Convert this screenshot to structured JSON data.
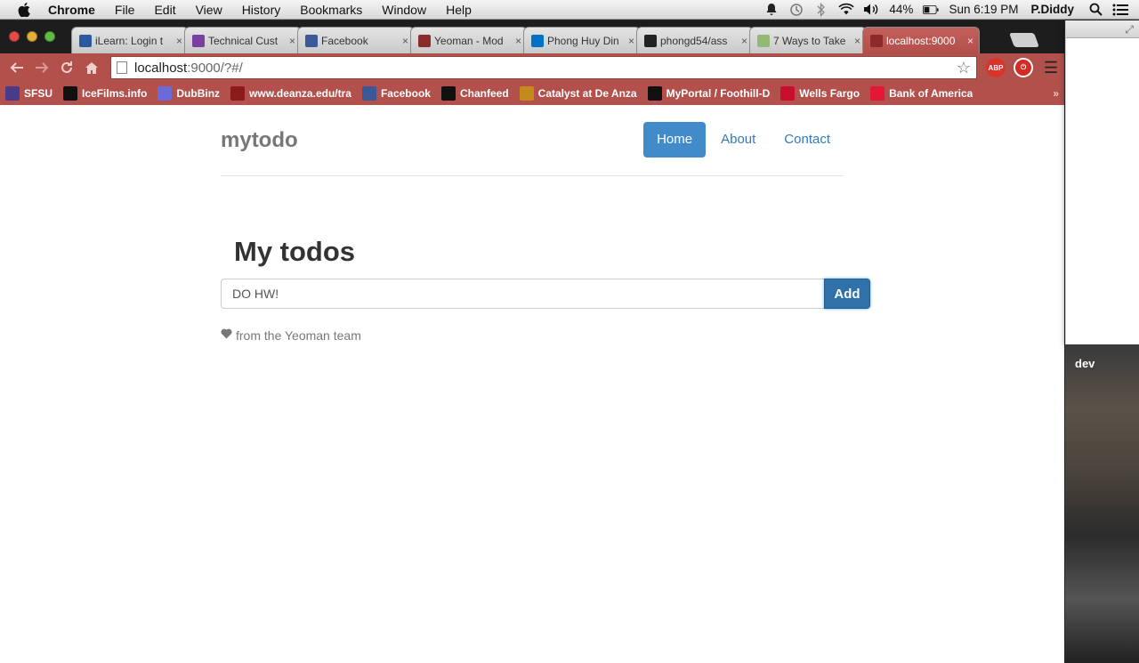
{
  "menubar": {
    "app": "Chrome",
    "items": [
      "File",
      "Edit",
      "View",
      "History",
      "Bookmarks",
      "Window",
      "Help"
    ],
    "battery": "44%",
    "clock": "Sun 6:19 PM",
    "user": "P.Diddy"
  },
  "tabs": [
    {
      "label": "iLearn: Login t",
      "icon": "ilearn-icon",
      "color": "#2c5aa0"
    },
    {
      "label": "Technical Cust",
      "icon": "peace-icon",
      "color": "#7b3fa0"
    },
    {
      "label": "Facebook",
      "icon": "facebook-icon",
      "color": "#3b5998"
    },
    {
      "label": "Yeoman - Mod",
      "icon": "yeoman-icon",
      "color": "#8b2b2b"
    },
    {
      "label": "Phong Huy Din",
      "icon": "outlook-icon",
      "color": "#0072c6"
    },
    {
      "label": "phongd54/ass",
      "icon": "github-icon",
      "color": "#222222"
    },
    {
      "label": "7 Ways to Take",
      "icon": "wikihow-icon",
      "color": "#93b874"
    },
    {
      "label": "localhost:9000",
      "icon": "yeoman-icon",
      "color": "#8b2b2b",
      "active": true
    }
  ],
  "address": {
    "host": "localhost",
    "path": ":9000/?#/"
  },
  "bookmarks": [
    {
      "label": "SFSU",
      "icon": "sfsu-icon",
      "color": "#4a3a8a"
    },
    {
      "label": "IceFilms.info",
      "icon": "icefilms-icon",
      "color": "#111111"
    },
    {
      "label": "DubBinz",
      "icon": "dubbinz-icon",
      "color": "#6a6ad8"
    },
    {
      "label": "www.deanza.edu/tra",
      "icon": "deanza-icon",
      "color": "#8b1a1a"
    },
    {
      "label": "Facebook",
      "icon": "facebook-icon",
      "color": "#3b5998"
    },
    {
      "label": "Chanfeed",
      "icon": "yinyang-icon",
      "color": "#111111"
    },
    {
      "label": "Catalyst at De Anza",
      "icon": "catalyst-icon",
      "color": "#c48a1a"
    },
    {
      "label": "MyPortal / Foothill-D",
      "icon": "myportal-icon",
      "color": "#111111"
    },
    {
      "label": "Wells Fargo",
      "icon": "wellsfargo-icon",
      "color": "#c8102e"
    },
    {
      "label": "Bank of America",
      "icon": "boa-icon",
      "color": "#e31837"
    }
  ],
  "page": {
    "brand": "mytodo",
    "nav": [
      {
        "label": "Home",
        "active": true
      },
      {
        "label": "About"
      },
      {
        "label": "Contact"
      }
    ],
    "title": "My todos",
    "todo_input_value": "DO HW!",
    "add_label": "Add",
    "footer_text": "from the Yeoman team"
  },
  "desktop": {
    "label": "dev"
  },
  "colors": {
    "chrome_theme": "#b2504c",
    "nav_active": "#428bca",
    "link": "#337ab7",
    "add_button": "#3071a9"
  }
}
